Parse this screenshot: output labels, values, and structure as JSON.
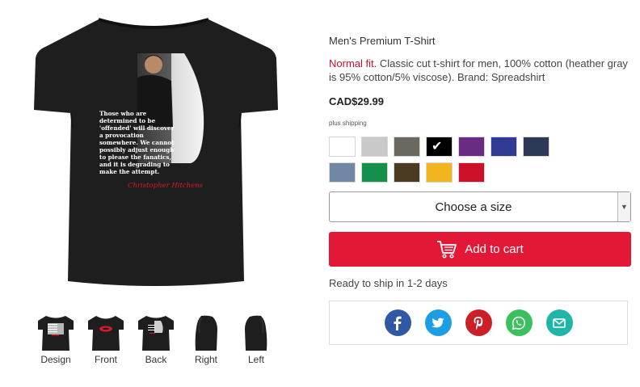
{
  "product": {
    "title": "Men's Premium T-Shirt",
    "fit_label": "Normal fit.",
    "description": " Classic cut t-shirt for men, 100% cotton (heather gray is 95% cotton/5% viscose). Brand: Spreadshirt",
    "price": "CAD$29.99",
    "shipping": "plus shipping",
    "shirt_color": "#1e1e1e",
    "print": {
      "quote_lines": [
        "Those who are",
        "determined to be",
        "'offended' will discover",
        "a provocation",
        "somewhere. We cannot",
        "possibly adjust enough",
        "to please the fanatics,",
        "and it is degrading to",
        "make the attempt."
      ],
      "signature": "Christopher Hitchens"
    }
  },
  "colors": [
    {
      "name": "white",
      "hex": "#ffffff",
      "selected": false
    },
    {
      "name": "heather-gray",
      "hex": "#c9c9c9",
      "selected": false
    },
    {
      "name": "charcoal",
      "hex": "#6b6862",
      "selected": false
    },
    {
      "name": "black",
      "hex": "#000000",
      "selected": true
    },
    {
      "name": "purple",
      "hex": "#6a2c82",
      "selected": false
    },
    {
      "name": "royal-blue",
      "hex": "#2f3b93",
      "selected": false
    },
    {
      "name": "navy",
      "hex": "#2c3a57",
      "selected": false
    },
    {
      "name": "denim",
      "hex": "#7088a6",
      "selected": false
    },
    {
      "name": "kelly-green",
      "hex": "#14904b",
      "selected": false
    },
    {
      "name": "brown",
      "hex": "#4b3a22",
      "selected": false
    },
    {
      "name": "gold",
      "hex": "#f3b51d",
      "selected": false
    },
    {
      "name": "red",
      "hex": "#cc1126",
      "selected": false
    }
  ],
  "size_select": {
    "label": "Choose a size"
  },
  "cart": {
    "label": "Add to cart",
    "color": "#e21836"
  },
  "ready": "Ready to ship in 1-2 days",
  "share": [
    {
      "name": "facebook-icon",
      "color": "#2f5aa3"
    },
    {
      "name": "twitter-icon",
      "color": "#1b9ee3"
    },
    {
      "name": "pinterest-icon",
      "color": "#cc1f27"
    },
    {
      "name": "whatsapp-icon",
      "color": "#3ac15e"
    },
    {
      "name": "email-icon",
      "color": "#1fb6a8"
    }
  ],
  "views": [
    {
      "label": "Design",
      "icon": "design-view-icon"
    },
    {
      "label": "Front",
      "icon": "front-view-icon"
    },
    {
      "label": "Back",
      "icon": "back-view-icon"
    },
    {
      "label": "Right",
      "icon": "right-view-icon"
    },
    {
      "label": "Left",
      "icon": "left-view-icon"
    }
  ]
}
